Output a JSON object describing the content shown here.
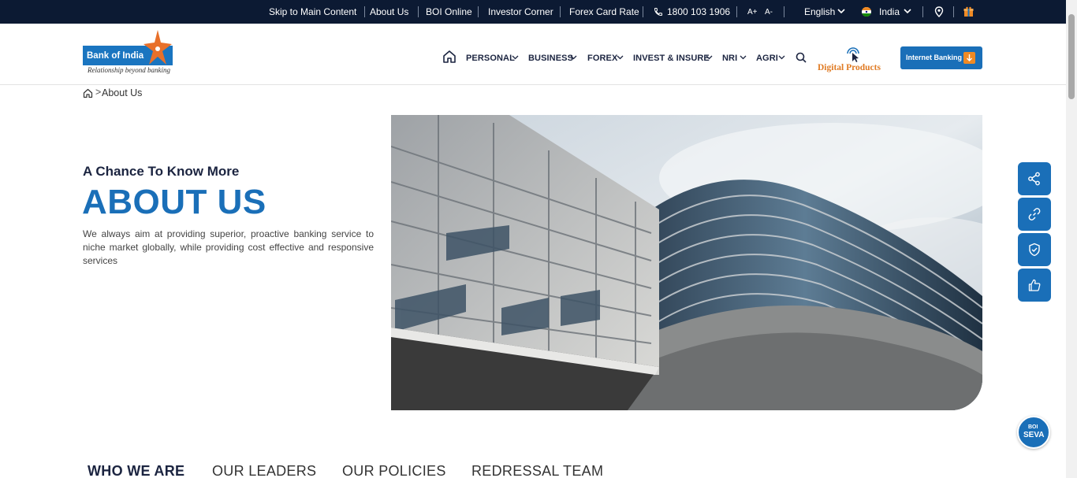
{
  "topbar": {
    "skip_link": "Skip to Main Content",
    "about_link": "About Us",
    "boi_online": "BOI Online",
    "investor_corner": "Investor Corner",
    "forex_rate": "Forex Card Rate",
    "phone": "1800 103 1906",
    "font_increase": "A+",
    "font_decrease": "A-",
    "language": "English",
    "country": "India"
  },
  "header": {
    "logo_name": "Bank of India",
    "logo_tagline": "Relationship beyond banking",
    "nav": {
      "personal": "PERSONAL",
      "business": "BUSINESS",
      "forex": "FOREX",
      "invest": "INVEST & INSURE",
      "nri": "NRI",
      "agri": "AGRI"
    },
    "digital_products": "Digital Products",
    "internet_banking": "Internet Banking"
  },
  "breadcrumb": {
    "current": "About Us"
  },
  "hero": {
    "eyebrow": "A Chance To Know More",
    "title": "ABOUT US",
    "description": "We always aim at providing superior, proactive banking service to niche market globally, while providing cost effective and responsive services"
  },
  "side_buttons": [
    "share-icon",
    "link-icon",
    "shield-icon",
    "thumbs-up-icon"
  ],
  "seva": {
    "line1": "BOI",
    "line2": "SEVA"
  },
  "tabs": {
    "who": "WHO WE ARE",
    "leaders": "OUR LEADERS",
    "policies": "OUR POLICIES",
    "redressal": "REDRESSAL TEAM"
  },
  "colors": {
    "brand_blue": "#1a6fb8",
    "topbar_navy": "#0c1a33",
    "accent_orange": "#f08a24"
  }
}
